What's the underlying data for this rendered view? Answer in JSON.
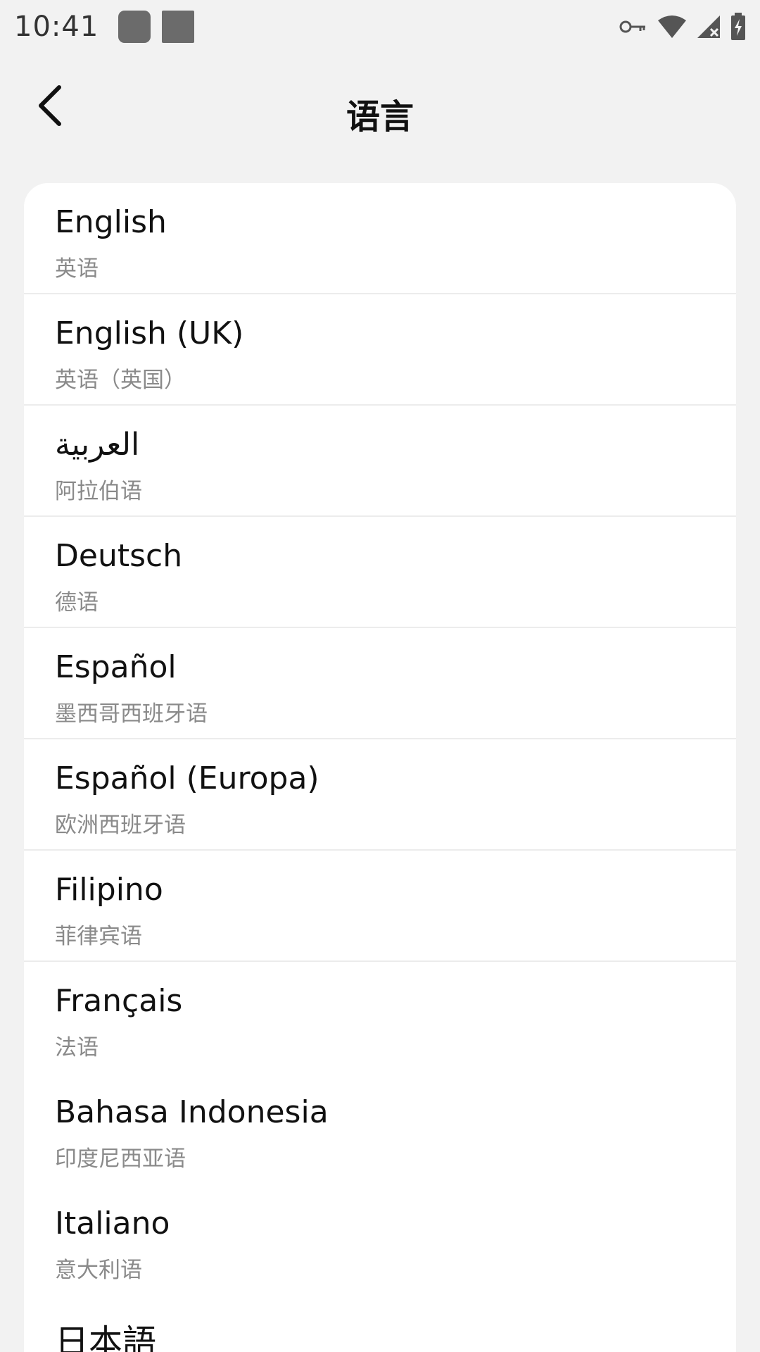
{
  "status_bar": {
    "time": "10:41",
    "icons": [
      "notification-icon",
      "notification-icon",
      "vpn-key-icon",
      "wifi-icon",
      "signal-icon",
      "battery-charging-icon"
    ]
  },
  "header": {
    "title": "语言",
    "back_icon": "chevron-left-icon"
  },
  "languages": [
    {
      "name": "English",
      "subtitle": "英语"
    },
    {
      "name": "English (UK)",
      "subtitle": "英语（英国）"
    },
    {
      "name": "العربية",
      "subtitle": "阿拉伯语"
    },
    {
      "name": "Deutsch",
      "subtitle": "德语"
    },
    {
      "name": "Español",
      "subtitle": "墨西哥西班牙语"
    },
    {
      "name": "Español (Europa)",
      "subtitle": "欧洲西班牙语"
    },
    {
      "name": "Filipino",
      "subtitle": "菲律宾语"
    },
    {
      "name": "Français",
      "subtitle": "法语"
    },
    {
      "name": "Bahasa Indonesia",
      "subtitle": "印度尼西亚语"
    },
    {
      "name": "Italiano",
      "subtitle": "意大利语"
    },
    {
      "name": "日本語",
      "subtitle": ""
    }
  ],
  "colors": {
    "background": "#f2f2f2",
    "card": "#ffffff",
    "primary_text": "#111111",
    "secondary_text": "#8a8a8a",
    "divider": "#ececec"
  }
}
